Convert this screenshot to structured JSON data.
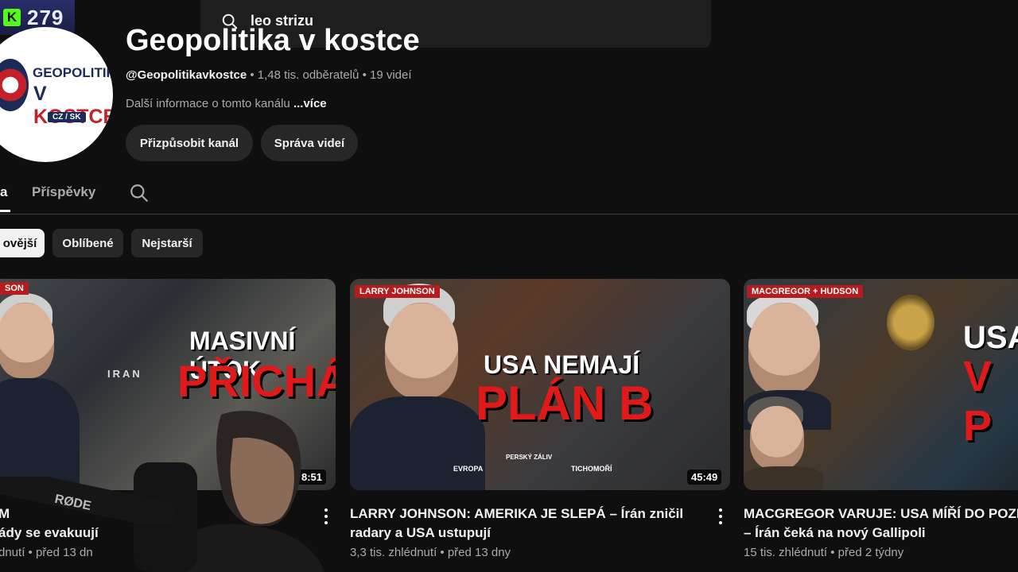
{
  "overlay": {
    "platform_logo": "K",
    "viewer_count": "279"
  },
  "search": {
    "query": "leo strizu"
  },
  "channel": {
    "title": "Geopolitika v kostce",
    "handle": "@Geopolitikavkostce",
    "subscribers": "1,48 tis. odběratelů",
    "videos": "19 videí",
    "separator": "•",
    "description": "Další informace o tomto kanálu",
    "more_label": "...více",
    "logo": {
      "line1": "GEOPOLITIKA",
      "line2a": "V ",
      "line2b": "KOSTCE",
      "badge": "CZ / SK"
    }
  },
  "actions": {
    "customize": "Přizpůsobit kanál",
    "manage": "Správa videí"
  },
  "tabs": {
    "active": "a",
    "posts": "Příspěvky"
  },
  "chips": [
    "ovější",
    "Oblíbené",
    "Nejstarší"
  ],
  "videos": [
    {
      "tag": "SON",
      "headline_top": "MASIVNÍ ÚTOK",
      "headline_main": "PŘICHÁZÍ",
      "map_label": "IRAN",
      "duration": "8:51",
      "title_line1": "",
      "title_line2": "ády se evakuují",
      "meta": "dnutí • před 13 dn",
      "title_partial": "M"
    },
    {
      "tag": "LARRY JOHNSON",
      "headline_top": "USA NEMAJÍ",
      "headline_main": "PLÁN B",
      "map_labels": [
        "EVROPA",
        "PERSKÝ ZÁLIV",
        "TICHOMOŘÍ"
      ],
      "duration": "45:49",
      "title_line1": "LARRY JOHNSON: AMERIKA JE SLEPÁ – Írán zničil",
      "title_line2": "radary a USA ustupují",
      "meta": "3,3 tis. zhlédnutí • před 13 dny"
    },
    {
      "tag": "MACGREGOR + HUDSON",
      "headline_top": "USA",
      "headline_main": "V P",
      "title_line1": "MACGREGOR VARUJE: USA MÍŘÍ DO POZE",
      "title_line2": "– Írán čeká na nový Gallipoli",
      "meta": "15 tis. zhlédnutí • před 2 týdny"
    }
  ],
  "mic_brand": "RØDE"
}
